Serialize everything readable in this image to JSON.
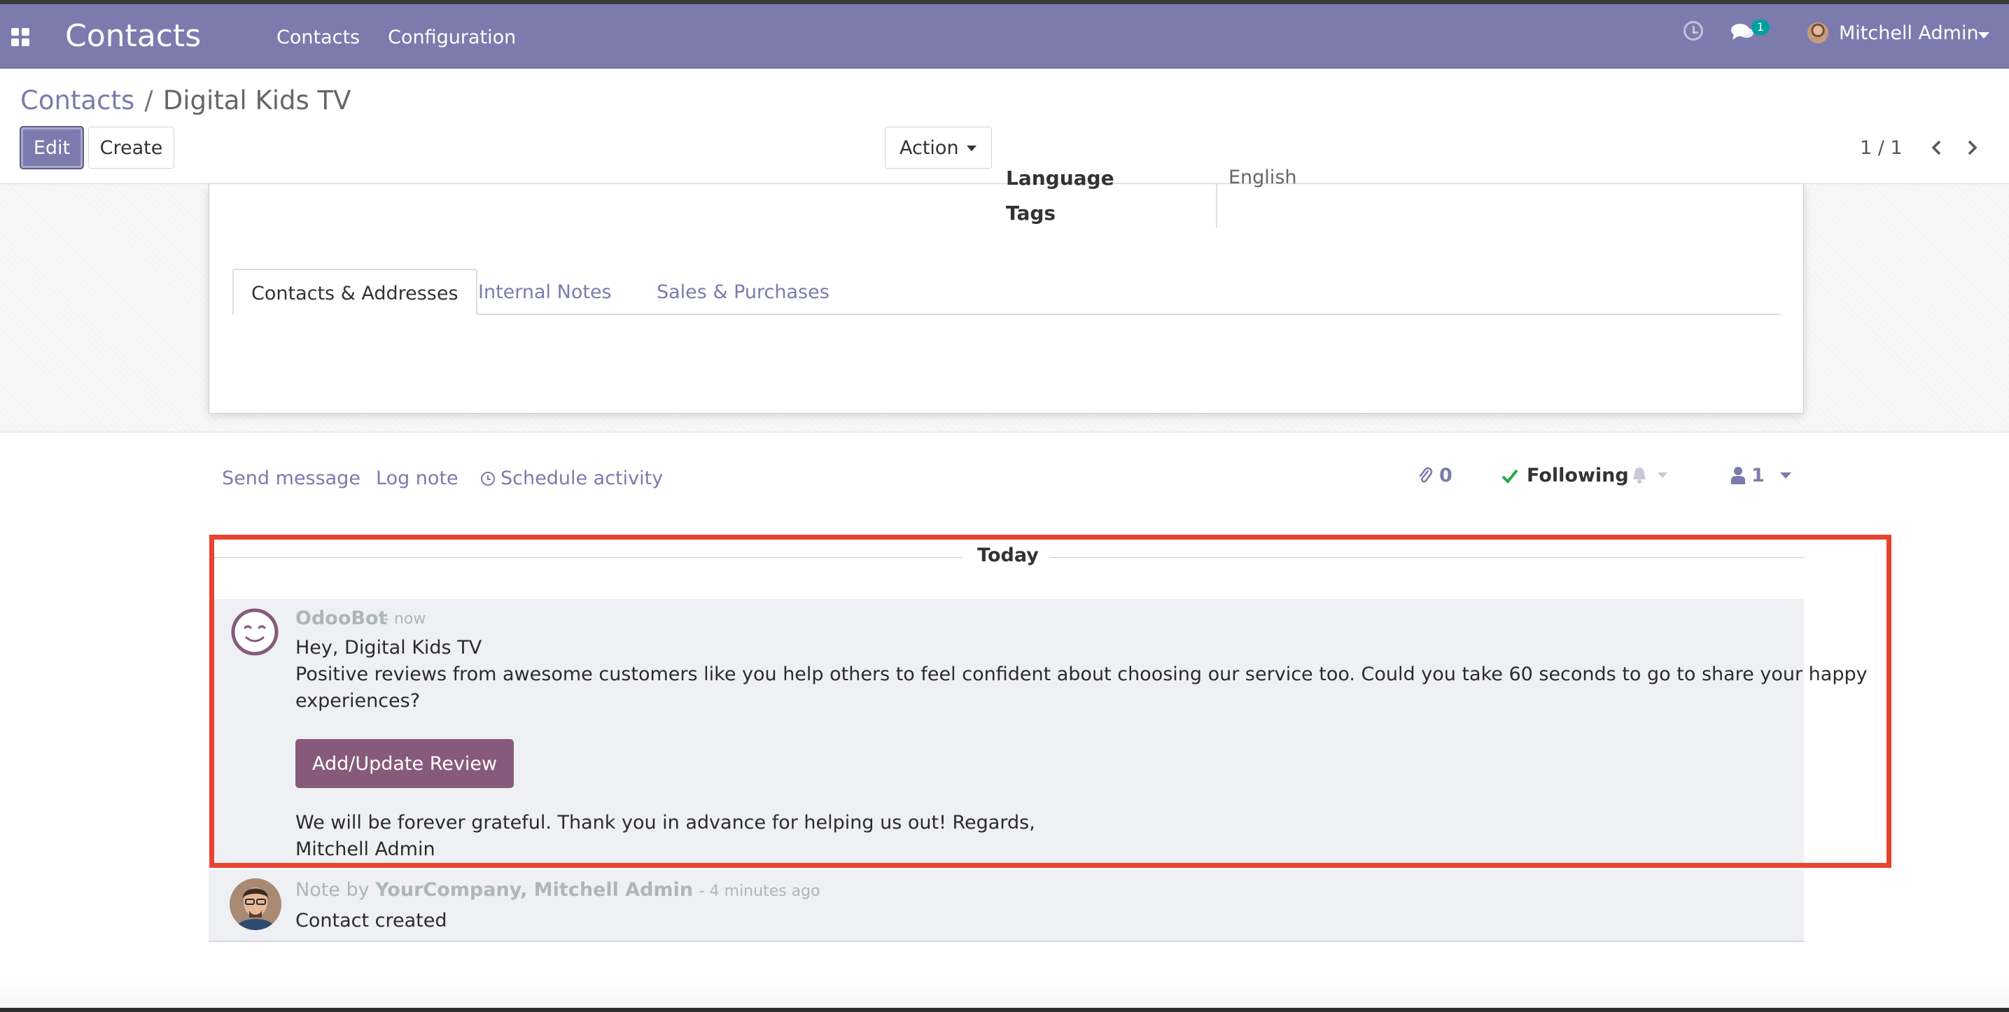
{
  "navbar": {
    "brand": "Contacts",
    "menu": [
      "Contacts",
      "Configuration"
    ],
    "chat_badge": "1",
    "user_name": "Mitchell Admin",
    "color": "#7c7bad"
  },
  "breadcrumb": {
    "parent": "Contacts",
    "separator": "/",
    "current": "Digital Kids TV"
  },
  "toolbar": {
    "edit_label": "Edit",
    "create_label": "Create",
    "action_label": "Action",
    "pager": "1 / 1"
  },
  "form": {
    "partial_field_label": "Language",
    "partial_field_value": "English",
    "tags_label": "Tags",
    "tabs": [
      "Contacts & Addresses",
      "Internal Notes",
      "Sales & Purchases"
    ],
    "active_tab": "Contacts & Addresses"
  },
  "chatter": {
    "send_message": "Send message",
    "log_note": "Log note",
    "schedule_activity": "Schedule activity",
    "attachment_count": "0",
    "following_label": "Following",
    "follower_count": "1",
    "date_separator": "Today",
    "messages": [
      {
        "author": "OdooBot",
        "date": "- now",
        "lines": [
          "Hey, Digital Kids TV",
          "Positive reviews from awesome customers like you help others to feel confident about choosing our service too. Could you take 60 seconds to go to share your happy",
          "experiences?"
        ],
        "button_label": "Add/Update Review",
        "closing_lines": [
          "We will be forever grateful. Thank you in advance for helping us out! Regards,",
          "Mitchell Admin"
        ]
      },
      {
        "prefix": "Note by",
        "author": "YourCompany, Mitchell Admin",
        "date": "- 4 minutes ago",
        "body": "Contact created"
      }
    ]
  },
  "colors": {
    "accent": "#7c7bad",
    "review_button": "#875a7b",
    "highlight": "#e8432f",
    "following_check": "#28a745"
  }
}
